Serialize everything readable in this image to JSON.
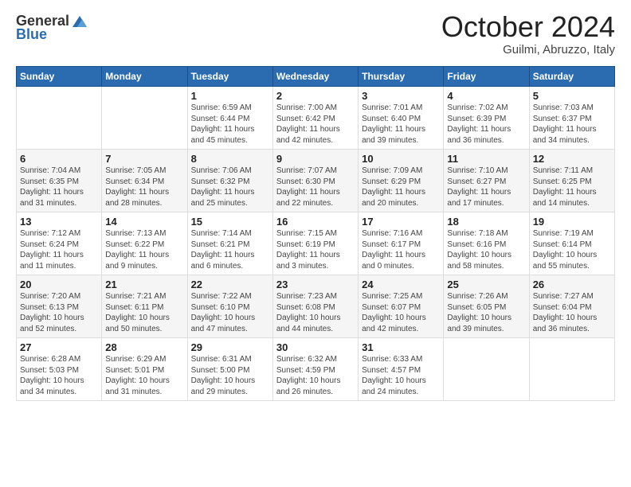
{
  "logo": {
    "general": "General",
    "blue": "Blue"
  },
  "title": "October 2024",
  "subtitle": "Guilmi, Abruzzo, Italy",
  "weekdays": [
    "Sunday",
    "Monday",
    "Tuesday",
    "Wednesday",
    "Thursday",
    "Friday",
    "Saturday"
  ],
  "weeks": [
    [
      {
        "day": "",
        "sunrise": "",
        "sunset": "",
        "daylight": ""
      },
      {
        "day": "",
        "sunrise": "",
        "sunset": "",
        "daylight": ""
      },
      {
        "day": "1",
        "sunrise": "Sunrise: 6:59 AM",
        "sunset": "Sunset: 6:44 PM",
        "daylight": "Daylight: 11 hours and 45 minutes."
      },
      {
        "day": "2",
        "sunrise": "Sunrise: 7:00 AM",
        "sunset": "Sunset: 6:42 PM",
        "daylight": "Daylight: 11 hours and 42 minutes."
      },
      {
        "day": "3",
        "sunrise": "Sunrise: 7:01 AM",
        "sunset": "Sunset: 6:40 PM",
        "daylight": "Daylight: 11 hours and 39 minutes."
      },
      {
        "day": "4",
        "sunrise": "Sunrise: 7:02 AM",
        "sunset": "Sunset: 6:39 PM",
        "daylight": "Daylight: 11 hours and 36 minutes."
      },
      {
        "day": "5",
        "sunrise": "Sunrise: 7:03 AM",
        "sunset": "Sunset: 6:37 PM",
        "daylight": "Daylight: 11 hours and 34 minutes."
      }
    ],
    [
      {
        "day": "6",
        "sunrise": "Sunrise: 7:04 AM",
        "sunset": "Sunset: 6:35 PM",
        "daylight": "Daylight: 11 hours and 31 minutes."
      },
      {
        "day": "7",
        "sunrise": "Sunrise: 7:05 AM",
        "sunset": "Sunset: 6:34 PM",
        "daylight": "Daylight: 11 hours and 28 minutes."
      },
      {
        "day": "8",
        "sunrise": "Sunrise: 7:06 AM",
        "sunset": "Sunset: 6:32 PM",
        "daylight": "Daylight: 11 hours and 25 minutes."
      },
      {
        "day": "9",
        "sunrise": "Sunrise: 7:07 AM",
        "sunset": "Sunset: 6:30 PM",
        "daylight": "Daylight: 11 hours and 22 minutes."
      },
      {
        "day": "10",
        "sunrise": "Sunrise: 7:09 AM",
        "sunset": "Sunset: 6:29 PM",
        "daylight": "Daylight: 11 hours and 20 minutes."
      },
      {
        "day": "11",
        "sunrise": "Sunrise: 7:10 AM",
        "sunset": "Sunset: 6:27 PM",
        "daylight": "Daylight: 11 hours and 17 minutes."
      },
      {
        "day": "12",
        "sunrise": "Sunrise: 7:11 AM",
        "sunset": "Sunset: 6:25 PM",
        "daylight": "Daylight: 11 hours and 14 minutes."
      }
    ],
    [
      {
        "day": "13",
        "sunrise": "Sunrise: 7:12 AM",
        "sunset": "Sunset: 6:24 PM",
        "daylight": "Daylight: 11 hours and 11 minutes."
      },
      {
        "day": "14",
        "sunrise": "Sunrise: 7:13 AM",
        "sunset": "Sunset: 6:22 PM",
        "daylight": "Daylight: 11 hours and 9 minutes."
      },
      {
        "day": "15",
        "sunrise": "Sunrise: 7:14 AM",
        "sunset": "Sunset: 6:21 PM",
        "daylight": "Daylight: 11 hours and 6 minutes."
      },
      {
        "day": "16",
        "sunrise": "Sunrise: 7:15 AM",
        "sunset": "Sunset: 6:19 PM",
        "daylight": "Daylight: 11 hours and 3 minutes."
      },
      {
        "day": "17",
        "sunrise": "Sunrise: 7:16 AM",
        "sunset": "Sunset: 6:17 PM",
        "daylight": "Daylight: 11 hours and 0 minutes."
      },
      {
        "day": "18",
        "sunrise": "Sunrise: 7:18 AM",
        "sunset": "Sunset: 6:16 PM",
        "daylight": "Daylight: 10 hours and 58 minutes."
      },
      {
        "day": "19",
        "sunrise": "Sunrise: 7:19 AM",
        "sunset": "Sunset: 6:14 PM",
        "daylight": "Daylight: 10 hours and 55 minutes."
      }
    ],
    [
      {
        "day": "20",
        "sunrise": "Sunrise: 7:20 AM",
        "sunset": "Sunset: 6:13 PM",
        "daylight": "Daylight: 10 hours and 52 minutes."
      },
      {
        "day": "21",
        "sunrise": "Sunrise: 7:21 AM",
        "sunset": "Sunset: 6:11 PM",
        "daylight": "Daylight: 10 hours and 50 minutes."
      },
      {
        "day": "22",
        "sunrise": "Sunrise: 7:22 AM",
        "sunset": "Sunset: 6:10 PM",
        "daylight": "Daylight: 10 hours and 47 minutes."
      },
      {
        "day": "23",
        "sunrise": "Sunrise: 7:23 AM",
        "sunset": "Sunset: 6:08 PM",
        "daylight": "Daylight: 10 hours and 44 minutes."
      },
      {
        "day": "24",
        "sunrise": "Sunrise: 7:25 AM",
        "sunset": "Sunset: 6:07 PM",
        "daylight": "Daylight: 10 hours and 42 minutes."
      },
      {
        "day": "25",
        "sunrise": "Sunrise: 7:26 AM",
        "sunset": "Sunset: 6:05 PM",
        "daylight": "Daylight: 10 hours and 39 minutes."
      },
      {
        "day": "26",
        "sunrise": "Sunrise: 7:27 AM",
        "sunset": "Sunset: 6:04 PM",
        "daylight": "Daylight: 10 hours and 36 minutes."
      }
    ],
    [
      {
        "day": "27",
        "sunrise": "Sunrise: 6:28 AM",
        "sunset": "Sunset: 5:03 PM",
        "daylight": "Daylight: 10 hours and 34 minutes."
      },
      {
        "day": "28",
        "sunrise": "Sunrise: 6:29 AM",
        "sunset": "Sunset: 5:01 PM",
        "daylight": "Daylight: 10 hours and 31 minutes."
      },
      {
        "day": "29",
        "sunrise": "Sunrise: 6:31 AM",
        "sunset": "Sunset: 5:00 PM",
        "daylight": "Daylight: 10 hours and 29 minutes."
      },
      {
        "day": "30",
        "sunrise": "Sunrise: 6:32 AM",
        "sunset": "Sunset: 4:59 PM",
        "daylight": "Daylight: 10 hours and 26 minutes."
      },
      {
        "day": "31",
        "sunrise": "Sunrise: 6:33 AM",
        "sunset": "Sunset: 4:57 PM",
        "daylight": "Daylight: 10 hours and 24 minutes."
      },
      {
        "day": "",
        "sunrise": "",
        "sunset": "",
        "daylight": ""
      },
      {
        "day": "",
        "sunrise": "",
        "sunset": "",
        "daylight": ""
      }
    ]
  ]
}
